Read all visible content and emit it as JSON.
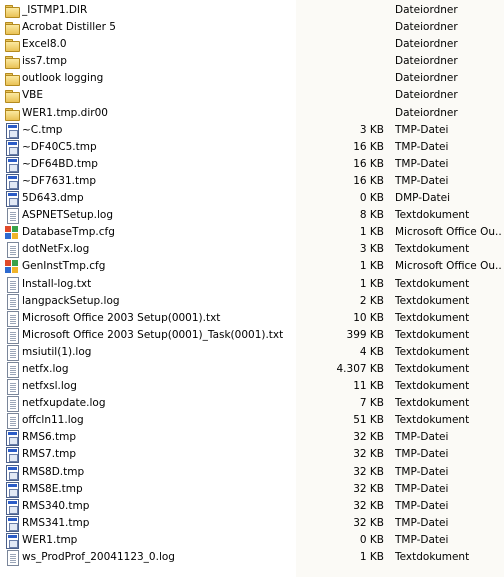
{
  "files": [
    {
      "name": "_ISTMP1.DIR",
      "size": "",
      "type": "Dateiordner",
      "icon": "folder-icon"
    },
    {
      "name": "Acrobat Distiller 5",
      "size": "",
      "type": "Dateiordner",
      "icon": "folder-icon"
    },
    {
      "name": "Excel8.0",
      "size": "",
      "type": "Dateiordner",
      "icon": "folder-icon"
    },
    {
      "name": "iss7.tmp",
      "size": "",
      "type": "Dateiordner",
      "icon": "folder-icon"
    },
    {
      "name": "outlook logging",
      "size": "",
      "type": "Dateiordner",
      "icon": "folder-icon"
    },
    {
      "name": "VBE",
      "size": "",
      "type": "Dateiordner",
      "icon": "folder-icon"
    },
    {
      "name": "WER1.tmp.dir00",
      "size": "",
      "type": "Dateiordner",
      "icon": "folder-icon"
    },
    {
      "name": "~C.tmp",
      "size": "3 KB",
      "type": "TMP-Datei",
      "icon": "tmp-file-icon"
    },
    {
      "name": "~DF40C5.tmp",
      "size": "16 KB",
      "type": "TMP-Datei",
      "icon": "tmp-file-icon"
    },
    {
      "name": "~DF64BD.tmp",
      "size": "16 KB",
      "type": "TMP-Datei",
      "icon": "tmp-file-icon"
    },
    {
      "name": "~DF7631.tmp",
      "size": "16 KB",
      "type": "TMP-Datei",
      "icon": "tmp-file-icon"
    },
    {
      "name": "5D643.dmp",
      "size": "0 KB",
      "type": "DMP-Datei",
      "icon": "tmp-file-icon"
    },
    {
      "name": "ASPNETSetup.log",
      "size": "8 KB",
      "type": "Textdokument",
      "icon": "text-document-icon"
    },
    {
      "name": "DatabaseTmp.cfg",
      "size": "1 KB",
      "type": "Microsoft Office Ou...",
      "icon": "office-config-icon"
    },
    {
      "name": "dotNetFx.log",
      "size": "3 KB",
      "type": "Textdokument",
      "icon": "text-document-icon"
    },
    {
      "name": "GenInstTmp.cfg",
      "size": "1 KB",
      "type": "Microsoft Office Ou...",
      "icon": "office-config-icon"
    },
    {
      "name": "Install-log.txt",
      "size": "1 KB",
      "type": "Textdokument",
      "icon": "text-document-icon"
    },
    {
      "name": "langpackSetup.log",
      "size": "2 KB",
      "type": "Textdokument",
      "icon": "text-document-icon"
    },
    {
      "name": "Microsoft Office 2003 Setup(0001).txt",
      "size": "10 KB",
      "type": "Textdokument",
      "icon": "text-document-icon"
    },
    {
      "name": "Microsoft Office 2003 Setup(0001)_Task(0001).txt",
      "size": "399 KB",
      "type": "Textdokument",
      "icon": "text-document-icon"
    },
    {
      "name": "msiutil(1).log",
      "size": "4 KB",
      "type": "Textdokument",
      "icon": "text-document-icon"
    },
    {
      "name": "netfx.log",
      "size": "4.307 KB",
      "type": "Textdokument",
      "icon": "text-document-icon"
    },
    {
      "name": "netfxsl.log",
      "size": "11 KB",
      "type": "Textdokument",
      "icon": "text-document-icon"
    },
    {
      "name": "netfxupdate.log",
      "size": "7 KB",
      "type": "Textdokument",
      "icon": "text-document-icon"
    },
    {
      "name": "offcln11.log",
      "size": "51 KB",
      "type": "Textdokument",
      "icon": "text-document-icon"
    },
    {
      "name": "RMS6.tmp",
      "size": "32 KB",
      "type": "TMP-Datei",
      "icon": "tmp-file-icon"
    },
    {
      "name": "RMS7.tmp",
      "size": "32 KB",
      "type": "TMP-Datei",
      "icon": "tmp-file-icon"
    },
    {
      "name": "RMS8D.tmp",
      "size": "32 KB",
      "type": "TMP-Datei",
      "icon": "tmp-file-icon"
    },
    {
      "name": "RMS8E.tmp",
      "size": "32 KB",
      "type": "TMP-Datei",
      "icon": "tmp-file-icon"
    },
    {
      "name": "RMS340.tmp",
      "size": "32 KB",
      "type": "TMP-Datei",
      "icon": "tmp-file-icon"
    },
    {
      "name": "RMS341.tmp",
      "size": "32 KB",
      "type": "TMP-Datei",
      "icon": "tmp-file-icon"
    },
    {
      "name": "WER1.tmp",
      "size": "0 KB",
      "type": "TMP-Datei",
      "icon": "tmp-file-icon"
    },
    {
      "name": "ws_ProdProf_20041123_0.log",
      "size": "1 KB",
      "type": "Textdokument",
      "icon": "text-document-icon"
    }
  ]
}
